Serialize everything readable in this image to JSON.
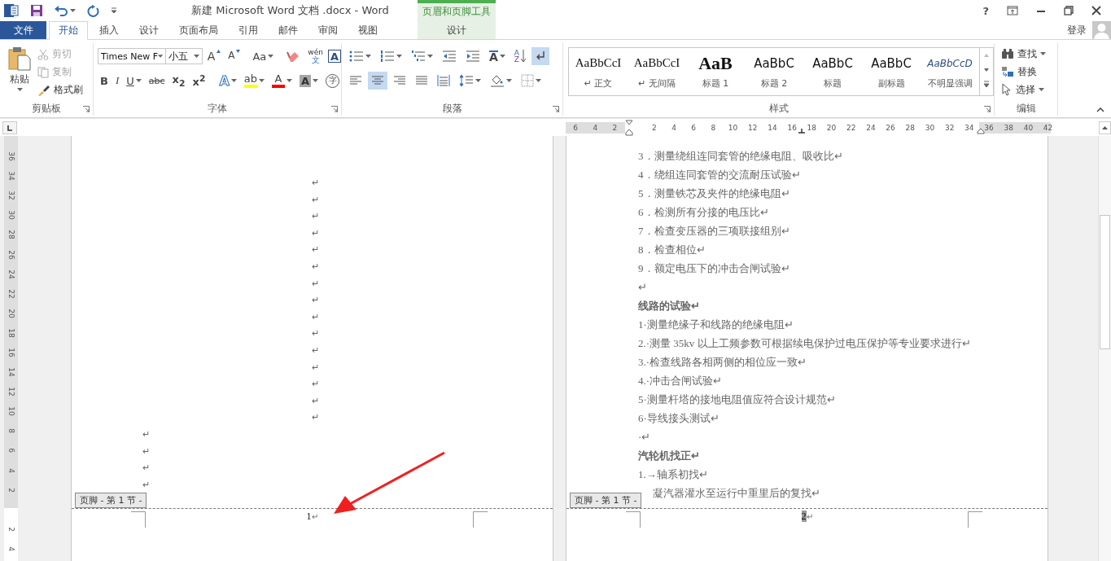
{
  "window": {
    "title": "新建 Microsoft Word 文档 .docx - Word",
    "context_group": "页眉和页脚工具",
    "help": "?"
  },
  "tabs": [
    {
      "label": "文件",
      "kind": "file",
      "selected": false
    },
    {
      "label": "开始",
      "kind": "normal",
      "selected": true
    },
    {
      "label": "插入",
      "kind": "normal",
      "selected": false
    },
    {
      "label": "设计",
      "kind": "normal",
      "selected": false
    },
    {
      "label": "页面布局",
      "kind": "normal",
      "selected": false
    },
    {
      "label": "引用",
      "kind": "normal",
      "selected": false
    },
    {
      "label": "邮件",
      "kind": "normal",
      "selected": false
    },
    {
      "label": "审阅",
      "kind": "normal",
      "selected": false
    },
    {
      "label": "视图",
      "kind": "normal",
      "selected": false
    },
    {
      "label": "设计",
      "kind": "contextual",
      "selected": false
    }
  ],
  "account": {
    "label": "登录"
  },
  "ribbon": {
    "clipboard": {
      "title": "剪贴板",
      "paste": "粘贴",
      "items": [
        {
          "kind": "cut",
          "label": "剪切",
          "disabled": true
        },
        {
          "kind": "copy",
          "label": "复制",
          "disabled": true
        },
        {
          "kind": "painter",
          "label": "格式刷",
          "disabled": false
        }
      ]
    },
    "font": {
      "title": "字体",
      "font_name": "Times New F",
      "font_size": "小五",
      "row1": [
        {
          "kind": "grow",
          "glyph": "A"
        },
        {
          "kind": "shrink",
          "glyph": "A"
        },
        {
          "kind": "case",
          "glyph": "Aa"
        },
        {
          "kind": "clear"
        },
        {
          "kind": "phonetic",
          "glyph": "wén",
          "sub": "文"
        },
        {
          "kind": "border",
          "glyph": "A"
        }
      ],
      "row2": [
        {
          "kind": "bold",
          "glyph": "B"
        },
        {
          "kind": "italic",
          "glyph": "I"
        },
        {
          "kind": "underline",
          "glyph": "U"
        },
        {
          "kind": "strike",
          "glyph": "abc"
        },
        {
          "kind": "subscript",
          "glyph": "x$_{2}$"
        },
        {
          "kind": "superscript",
          "glyph": "x$^{2}$"
        },
        {
          "kind": "effects",
          "glyph": "A"
        },
        {
          "kind": "highlight",
          "glyph": "ab"
        },
        {
          "kind": "color",
          "glyph": "A"
        },
        {
          "kind": "shading",
          "glyph": "A"
        },
        {
          "kind": "enclose",
          "glyph": "字"
        }
      ]
    },
    "paragraph": {
      "title": "段落",
      "row1": [
        {
          "kind": "bullets"
        },
        {
          "kind": "numbering"
        },
        {
          "kind": "multilevel"
        },
        {
          "kind": "outdent"
        },
        {
          "kind": "indent"
        },
        {
          "kind": "asian_layout",
          "glyph": "A"
        },
        {
          "kind": "sort",
          "glyph": "A",
          "sub": "Z"
        },
        {
          "kind": "show_marks",
          "selected": true
        }
      ],
      "row2": [
        {
          "kind": "align_left",
          "selected": false
        },
        {
          "kind": "align_center",
          "selected": true
        },
        {
          "kind": "align_right",
          "selected": false
        },
        {
          "kind": "justify",
          "selected": false
        },
        {
          "kind": "distribute",
          "selected": false
        },
        {
          "kind": "line_spacing"
        },
        {
          "kind": "shading"
        },
        {
          "kind": "borders"
        }
      ]
    },
    "styles": {
      "title": "样式",
      "items": [
        {
          "preview": "AaBbCcI",
          "label": "↵ 正文",
          "kind": "serif"
        },
        {
          "preview": "AaBbCcI",
          "label": "↵ 无间隔",
          "kind": "serif"
        },
        {
          "preview": "AaB",
          "label": "标题 1",
          "kind": "heading"
        },
        {
          "preview": "AaBbC",
          "label": "标题 2",
          "kind": "sans"
        },
        {
          "preview": "AaBbC",
          "label": "标题",
          "kind": "sans"
        },
        {
          "preview": "AaBbC",
          "label": "副标题",
          "kind": "sans"
        },
        {
          "preview": "AaBbCcD",
          "label": "不明显强调",
          "kind": "italic"
        }
      ]
    },
    "editing": {
      "title": "编辑",
      "items": [
        {
          "kind": "find",
          "label": "查找"
        },
        {
          "kind": "replace",
          "label": "替换"
        },
        {
          "kind": "select",
          "label": "选择"
        }
      ]
    }
  },
  "horizontal_ruler": {
    "labels": [
      {
        "text": "6",
        "kind": "margin"
      },
      {
        "text": "4",
        "kind": "margin"
      },
      {
        "text": "2",
        "kind": "margin"
      },
      {
        "text": "2",
        "kind": "body"
      },
      {
        "text": "4",
        "kind": "body"
      },
      {
        "text": "6",
        "kind": "body"
      },
      {
        "text": "8",
        "kind": "body"
      },
      {
        "text": "10",
        "kind": "body"
      },
      {
        "text": "12",
        "kind": "body"
      },
      {
        "text": "14",
        "kind": "body"
      },
      {
        "text": "16",
        "kind": "body"
      },
      {
        "text": "18",
        "kind": "body"
      },
      {
        "text": "20",
        "kind": "body"
      },
      {
        "text": "22",
        "kind": "body"
      },
      {
        "text": "24",
        "kind": "body"
      },
      {
        "text": "26",
        "kind": "body"
      },
      {
        "text": "28",
        "kind": "body"
      },
      {
        "text": "30",
        "kind": "body"
      },
      {
        "text": "32",
        "kind": "body"
      },
      {
        "text": "34",
        "kind": "body"
      },
      {
        "text": "36",
        "kind": "margin"
      },
      {
        "text": "38",
        "kind": "margin"
      },
      {
        "text": "40",
        "kind": "margin"
      },
      {
        "text": "42",
        "kind": "margin"
      }
    ]
  },
  "vertical_ruler": {
    "body_labels": [
      "36",
      "34",
      "32",
      "30",
      "28",
      "26",
      "24",
      "22",
      "20",
      "18",
      "16",
      "14",
      "12",
      "10",
      "8",
      "6",
      "4",
      "2"
    ],
    "footer_labels": [
      "2",
      "4"
    ]
  },
  "left_page": {
    "paragraphs": [
      {
        "text": "↵",
        "kind": "center"
      },
      {
        "text": "↵",
        "kind": "center"
      },
      {
        "text": "↵",
        "kind": "center"
      },
      {
        "text": "↵",
        "kind": "center"
      },
      {
        "text": "↵",
        "kind": "center"
      },
      {
        "text": "↵",
        "kind": "center"
      },
      {
        "text": "↵",
        "kind": "center"
      },
      {
        "text": "↵",
        "kind": "center"
      },
      {
        "text": "↵",
        "kind": "center"
      },
      {
        "text": "↵",
        "kind": "center"
      },
      {
        "text": "↵",
        "kind": "center"
      },
      {
        "text": "↵",
        "kind": "center"
      },
      {
        "text": "↵",
        "kind": "center"
      },
      {
        "text": "↵",
        "kind": "center"
      },
      {
        "text": "↵",
        "kind": "center"
      },
      {
        "text": "↵",
        "kind": "left"
      },
      {
        "text": "↵",
        "kind": "left"
      },
      {
        "text": "↵",
        "kind": "left"
      },
      {
        "text": "↵",
        "kind": "left"
      }
    ],
    "footer": {
      "tag": "页脚 - 第 1 节 -",
      "page_number": "1",
      "mark": "↵",
      "highlighted": false
    }
  },
  "right_page": {
    "lines": [
      {
        "text": "3．测量绕组连同套管的绝缘电阻、吸收比↵",
        "kind": "item"
      },
      {
        "text": "4．绕组连同套管的交流耐压试验↵",
        "kind": "item"
      },
      {
        "text": "5．测量铁芯及夹件的绝缘电阻↵",
        "kind": "item"
      },
      {
        "text": "6．检测所有分接的电压比↵",
        "kind": "item"
      },
      {
        "text": "7．检查变压器的三项联接组别↵",
        "kind": "item"
      },
      {
        "text": "8．检查相位↵",
        "kind": "item"
      },
      {
        "text": "9．额定电压下的冲击合闸试验↵",
        "kind": "item"
      },
      {
        "text": "↵",
        "kind": "item"
      },
      {
        "text": "线路的试验↵",
        "kind": "heading"
      },
      {
        "text": "1·测量绝缘子和线路的绝缘电阻↵",
        "kind": "item"
      },
      {
        "text": "2.·测量 35kv 以上工频参数可根据续电保护过电压保护等专业要求进行↵",
        "kind": "item"
      },
      {
        "text": "3.·检查线路各相两侧的相位应一致↵",
        "kind": "item"
      },
      {
        "text": "4.·冲击合闸试验↵",
        "kind": "item"
      },
      {
        "text": "5·测量杆塔的接地电阻值应符合设计规范↵",
        "kind": "item"
      },
      {
        "text": "6·导线接头测试↵",
        "kind": "item"
      },
      {
        "text": "·↵",
        "kind": "item"
      },
      {
        "text": "汽轮机找正↵",
        "kind": "heading"
      },
      {
        "text": "1.→轴系初找↵",
        "kind": "item"
      },
      {
        "text": "凝汽器灌水至运行中重里后的复找↵",
        "kind": "covered"
      }
    ],
    "footer": {
      "tag": "页脚 - 第 1 节 -",
      "page_number": "2",
      "mark": "↵",
      "highlighted": true
    }
  }
}
